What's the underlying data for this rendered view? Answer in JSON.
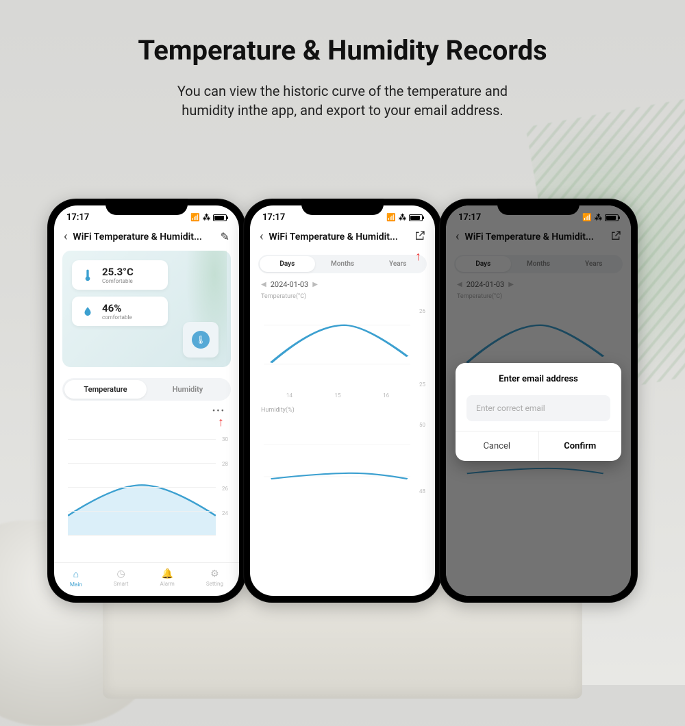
{
  "hero": {
    "title": "Temperature & Humidity Records",
    "subtitle_l1": "You can view the historic curve of the temperature and",
    "subtitle_l2": "humidity inthe app, and export to your email address."
  },
  "status": {
    "time": "17:17"
  },
  "nav": {
    "title": "WiFi Temperature & Humidit..."
  },
  "phone1": {
    "temp": {
      "value": "25.3°C",
      "label": "Comfortable"
    },
    "humidity": {
      "value": "46%",
      "label": "comfortable"
    },
    "segment": {
      "a": "Temperature",
      "b": "Humidity"
    },
    "yticks": [
      "30",
      "28",
      "26",
      "24",
      ""
    ],
    "tabs": {
      "main": "Main",
      "smart": "Smart",
      "alarm": "Alarm",
      "setting": "Setting"
    }
  },
  "phone2": {
    "segment": {
      "days": "Days",
      "months": "Months",
      "years": "Years"
    },
    "date": "2024-01-03",
    "temp_label": "Temperature(°C)",
    "humidity_label": "Humidity(%)",
    "temp_yticks": [
      "26",
      "25"
    ],
    "temp_xticks": [
      "14",
      "15",
      "16"
    ],
    "hum_yticks": [
      "50",
      "48"
    ]
  },
  "phone3": {
    "modal": {
      "title": "Enter email address",
      "placeholder": "Enter correct email",
      "cancel": "Cancel",
      "confirm": "Confirm"
    }
  },
  "chart_data": [
    {
      "type": "area",
      "phone": 1,
      "title": "Temperature",
      "ylabel": "°C",
      "ylim": [
        22,
        30
      ],
      "x": [
        0,
        1,
        2,
        3,
        4
      ],
      "values": [
        24,
        25.5,
        26,
        25.5,
        24
      ]
    },
    {
      "type": "line",
      "phone": 2,
      "title": "Temperature(°C)",
      "ylim": [
        24.5,
        26.5
      ],
      "x": [
        14,
        15,
        16
      ],
      "values": [
        25.2,
        26.0,
        25.3
      ]
    },
    {
      "type": "line",
      "phone": 2,
      "title": "Humidity(%)",
      "ylim": [
        47,
        51
      ],
      "x": [
        14,
        15,
        16
      ],
      "values": [
        48,
        48.3,
        48
      ]
    }
  ]
}
